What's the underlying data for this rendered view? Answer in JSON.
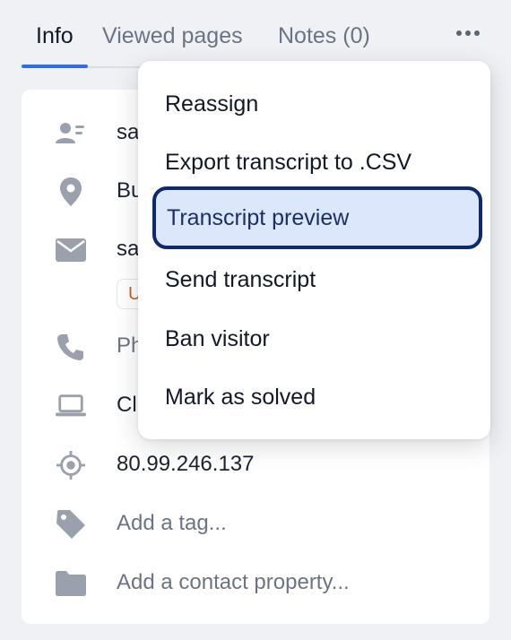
{
  "tabs": {
    "info": "Info",
    "viewed_pages": "Viewed pages",
    "notes": "Notes (0)"
  },
  "colors": {
    "accent": "#2f6ee8",
    "highlight_bg": "#dde7fb",
    "highlight_border": "#0f2a6a"
  },
  "info": {
    "name_partial": "sa",
    "location_partial": "Bu",
    "email_partial": "sa",
    "badge_partial": "U",
    "phone_partial": "Ph",
    "browser_partial": "Cl",
    "ip": "80.99.246.137",
    "tag_placeholder": "Add a tag...",
    "property_placeholder": "Add a contact property..."
  },
  "menu": {
    "reassign": "Reassign",
    "export_csv": "Export transcript to .CSV",
    "transcript_preview": "Transcript preview",
    "send_transcript": "Send transcript",
    "ban_visitor": "Ban visitor",
    "mark_solved": "Mark as solved"
  }
}
